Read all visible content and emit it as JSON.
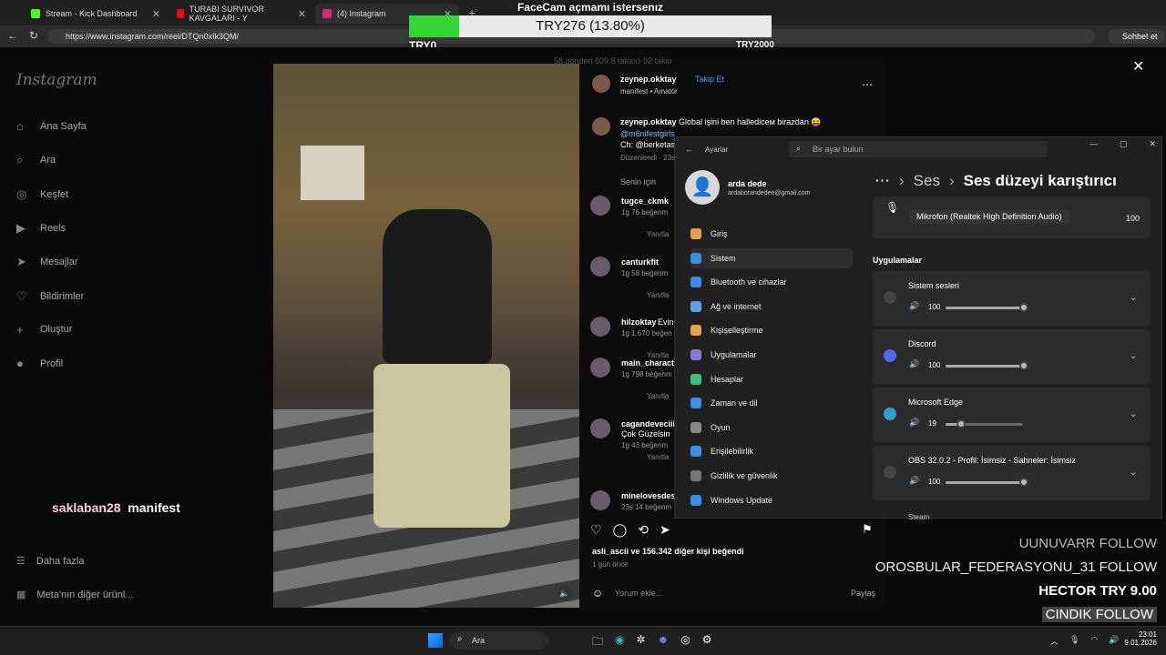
{
  "tabs": [
    {
      "label": "Stream - Kick Dashboard",
      "color": "#53fc18"
    },
    {
      "label": "TURABI SURVIVOR KAVGALARI - Y",
      "color": "#ff0000"
    },
    {
      "label": "(4) Instagram",
      "color": "#d62976"
    }
  ],
  "url": "https://www.instagram.com/reel/DTQn0xIk3QM/",
  "browser": {
    "copilot": "Sohbet et"
  },
  "donation": {
    "title": "FaceCam açmamı istersenız",
    "amount": "TRY276 (13.80%)",
    "min": "TRY0",
    "max": "TRY2000",
    "progress": 0.138
  },
  "instagram": {
    "logo": "Instagram",
    "stats": "58 gönderi   609,8 takipçi   92 takip",
    "nav": [
      "Ana Sayfa",
      "Ara",
      "Keşfet",
      "Reels",
      "Mesajlar",
      "Bildirimler",
      "Oluştur",
      "Profil"
    ],
    "more": "Daha fazla",
    "meta": "Meta'nın diğer ürünl...",
    "author": "zeynep.okktay",
    "follow": "Takip Et",
    "sub": "manifest • Amatör",
    "caption_user": "zeynep.okktay",
    "caption": "Global işini ben hallediceм birazdan 😝",
    "caption_tags": "@m6nifestgirls",
    "caption_ch": "Ch: @berketas",
    "edited": "Düzenlendi · 23s",
    "for_you": "Senin için",
    "comments": [
      {
        "user": "tugce_ckmk",
        "meta": "1g  76 beğenm"
      },
      {
        "user": "canturkfit",
        "meta": "1g  58 beğenm"
      },
      {
        "user": "hilzoktay",
        "text": "Evine",
        "meta": "1g  1.670 beğen"
      },
      {
        "user": "main_characte",
        "meta": "1g  798 beğenm"
      },
      {
        "user": "cagandeveciii",
        "text": "Çok Güzelsin",
        "meta": "1g  43 beğenm"
      },
      {
        "user": "minelovesdest",
        "meta": "23s  14 beğenm"
      }
    ],
    "reply": "Yanıtla",
    "likes": "asli_ascii ve 156.342 diğer kişi beğendi",
    "time": "1 gün önce",
    "comment_placeholder": "Yorum ekle...",
    "share": "Paylaş"
  },
  "overlay_text": {
    "user": "saklaban28",
    "msg": "manifest"
  },
  "settings": {
    "title": "Ayarlar",
    "search": "Bir ayar bulun",
    "user": "arda dede",
    "email": "ardaborandedee@gmail.com",
    "breadcrumb1": "Ses",
    "breadcrumb2": "Ses düzeyi karıştırıcı",
    "mic": "Mikrofon (Realtek High Definition Audio)",
    "mic_vol": "100",
    "apps_title": "Uygulamalar",
    "menu": [
      "Giriş",
      "Sistem",
      "Bluetooth ve cihazlar",
      "Ağ ve internet",
      "Kişiselleştirme",
      "Uygulamalar",
      "Hesaplar",
      "Zaman ve dil",
      "Oyun",
      "Erişilebilirlik",
      "Gizlilik ve güvenlik",
      "Windows Update"
    ],
    "apps": [
      {
        "name": "Sistem sesleri",
        "vol": "100",
        "level": 1.0
      },
      {
        "name": "Discord",
        "vol": "100",
        "level": 1.0
      },
      {
        "name": "Microsoft Edge",
        "vol": "19",
        "level": 0.19
      },
      {
        "name": "OBS 32.0.2 - Profil: İsimsiz - Sahneler: İsimsiz",
        "vol": "100",
        "level": 1.0
      }
    ],
    "steam": "Steam"
  },
  "alerts": [
    "UUNUVARR  FOLLOW",
    "OROSBULAR_FEDERASYONU_31  FOLLOW",
    "HECTOR  TRY 9.00",
    "CINDIK  FOLLOW"
  ],
  "taskbar": {
    "search": "Ara",
    "time": "23:01",
    "date": "9.01.2026"
  }
}
